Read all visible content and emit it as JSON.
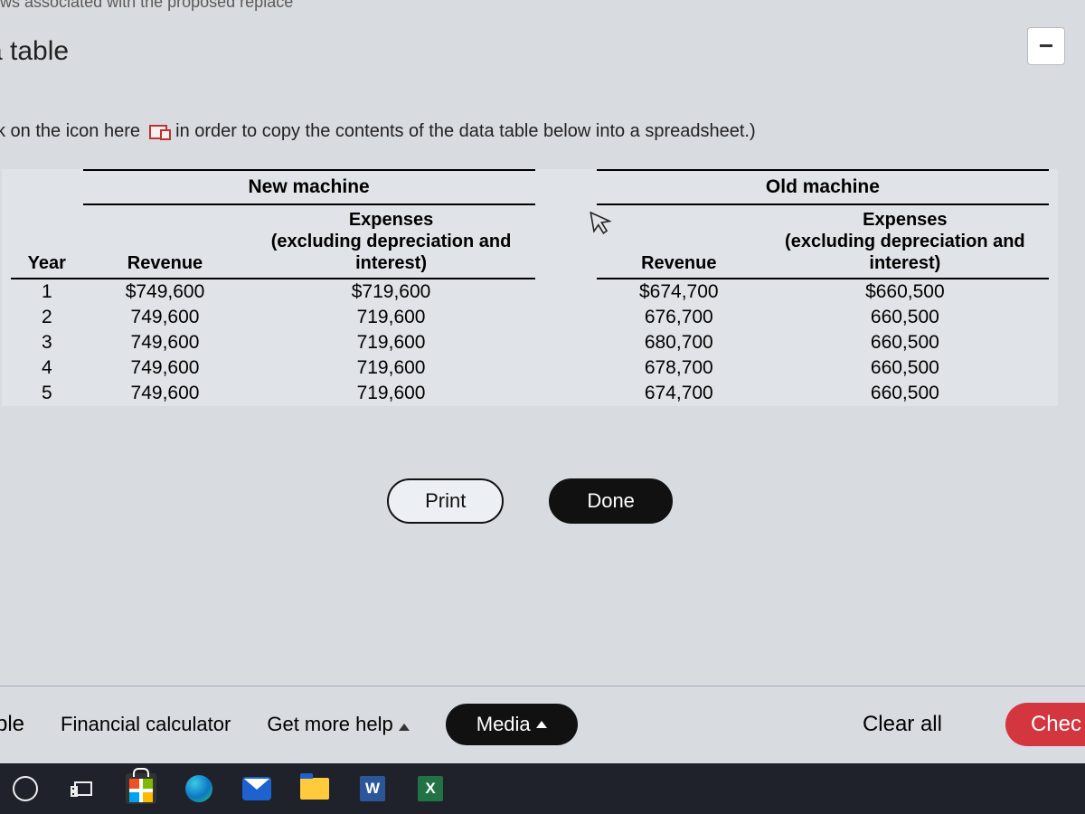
{
  "top_fragment": "Cash flows associated with the proposed replace",
  "minus": "−",
  "title_fragment": "a table",
  "instruction_prefix": "ck on the icon here",
  "instruction_suffix": "in order to copy the contents of the data table below into a spreadsheet.)",
  "group_headers": {
    "new": "New machine",
    "old": "Old machine"
  },
  "sub_headers": {
    "year": "Year",
    "revenue": "Revenue",
    "expenses_l1": "Expenses",
    "expenses_l2": "(excluding depreciation and",
    "expenses_l3": "interest)"
  },
  "rows": [
    {
      "year": "1",
      "new_rev": "$749,600",
      "new_exp": "$719,600",
      "old_rev": "$674,700",
      "old_exp": "$660,500"
    },
    {
      "year": "2",
      "new_rev": "749,600",
      "new_exp": "719,600",
      "old_rev": "676,700",
      "old_exp": "660,500"
    },
    {
      "year": "3",
      "new_rev": "749,600",
      "new_exp": "719,600",
      "old_rev": "680,700",
      "old_exp": "660,500"
    },
    {
      "year": "4",
      "new_rev": "749,600",
      "new_exp": "719,600",
      "old_rev": "678,700",
      "old_exp": "660,500"
    },
    {
      "year": "5",
      "new_rev": "749,600",
      "new_exp": "719,600",
      "old_rev": "674,700",
      "old_exp": "660,500"
    }
  ],
  "buttons": {
    "print": "Print",
    "done": "Done"
  },
  "footer": {
    "ple": "ple",
    "fc": "Financial calculator",
    "gmh": "Get more help",
    "media": "Media",
    "clear": "Clear all",
    "check": "Chec"
  },
  "taskbar": {
    "word": "W",
    "excel": "X"
  }
}
